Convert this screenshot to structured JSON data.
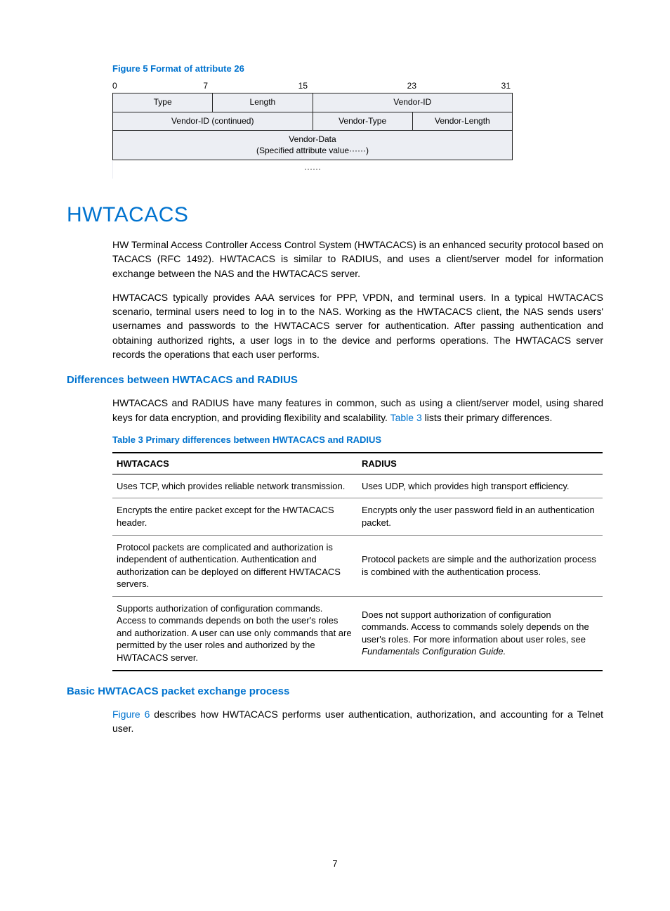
{
  "figure5": {
    "caption": "Figure 5 Format of attribute 26",
    "bits": [
      "0",
      "7",
      "15",
      "23",
      "31"
    ],
    "cells": {
      "type": "Type",
      "length": "Length",
      "vendor_id": "Vendor-ID",
      "vendor_id_cont": "Vendor-ID (continued)",
      "vendor_type": "Vendor-Type",
      "vendor_length": "Vendor-Length",
      "vendor_data_l1": "Vendor-Data",
      "vendor_data_l2": "(Specified attribute value······)",
      "dots": "······"
    }
  },
  "h1": "HWTACACS",
  "para1": "HW Terminal Access Controller Access Control System (HWTACACS) is an enhanced security protocol based on TACACS (RFC 1492). HWTACACS is similar to RADIUS, and uses a client/server model for information exchange between the NAS and the HWTACACS server.",
  "para2": "HWTACACS typically provides AAA services for PPP, VPDN, and terminal users. In a typical HWTACACS scenario, terminal users need to log in to the NAS. Working as the HWTACACS client, the NAS sends users' usernames and passwords to the HWTACACS server for authentication. After passing authentication and obtaining authorized rights, a user logs in to the device and performs operations. The HWTACACS server records the operations that each user performs.",
  "sub1": "Differences between HWTACACS and RADIUS",
  "para3_a": "HWTACACS and RADIUS have many features in common, such as using a client/server model, using shared keys for data encryption, and providing flexibility and scalability. ",
  "para3_link": "Table 3",
  "para3_b": " lists their primary differences.",
  "table3": {
    "caption": "Table 3 Primary differences between HWTACACS and RADIUS",
    "headers": [
      "HWTACACS",
      "RADIUS"
    ],
    "rows": [
      {
        "h": "Uses TCP, which provides reliable network transmission.",
        "r": "Uses UDP, which provides high transport efficiency."
      },
      {
        "h": "Encrypts the entire packet except for the HWTACACS header.",
        "r": "Encrypts only the user password field in an authentication packet."
      },
      {
        "h": "Protocol packets are complicated and authorization is independent of authentication. Authentication and authorization can be deployed on different HWTACACS servers.",
        "r": "Protocol packets are simple and the authorization process is combined with the authentication process."
      },
      {
        "h": "Supports authorization of configuration commands. Access to commands depends on both the user's roles and authorization. A user can use only commands that are permitted by the user roles and authorized by the HWTACACS server.",
        "r_a": "Does not support authorization of configuration commands. Access to commands solely depends on the user's roles. For more information about user roles, see ",
        "r_i": "Fundamentals Configuration Guide.",
        "r_b": ""
      }
    ]
  },
  "sub2": "Basic HWTACACS packet exchange process",
  "para4_link": "Figure 6",
  "para4_b": " describes how HWTACACS performs user authentication, authorization, and accounting for a Telnet user.",
  "page_number": "7"
}
